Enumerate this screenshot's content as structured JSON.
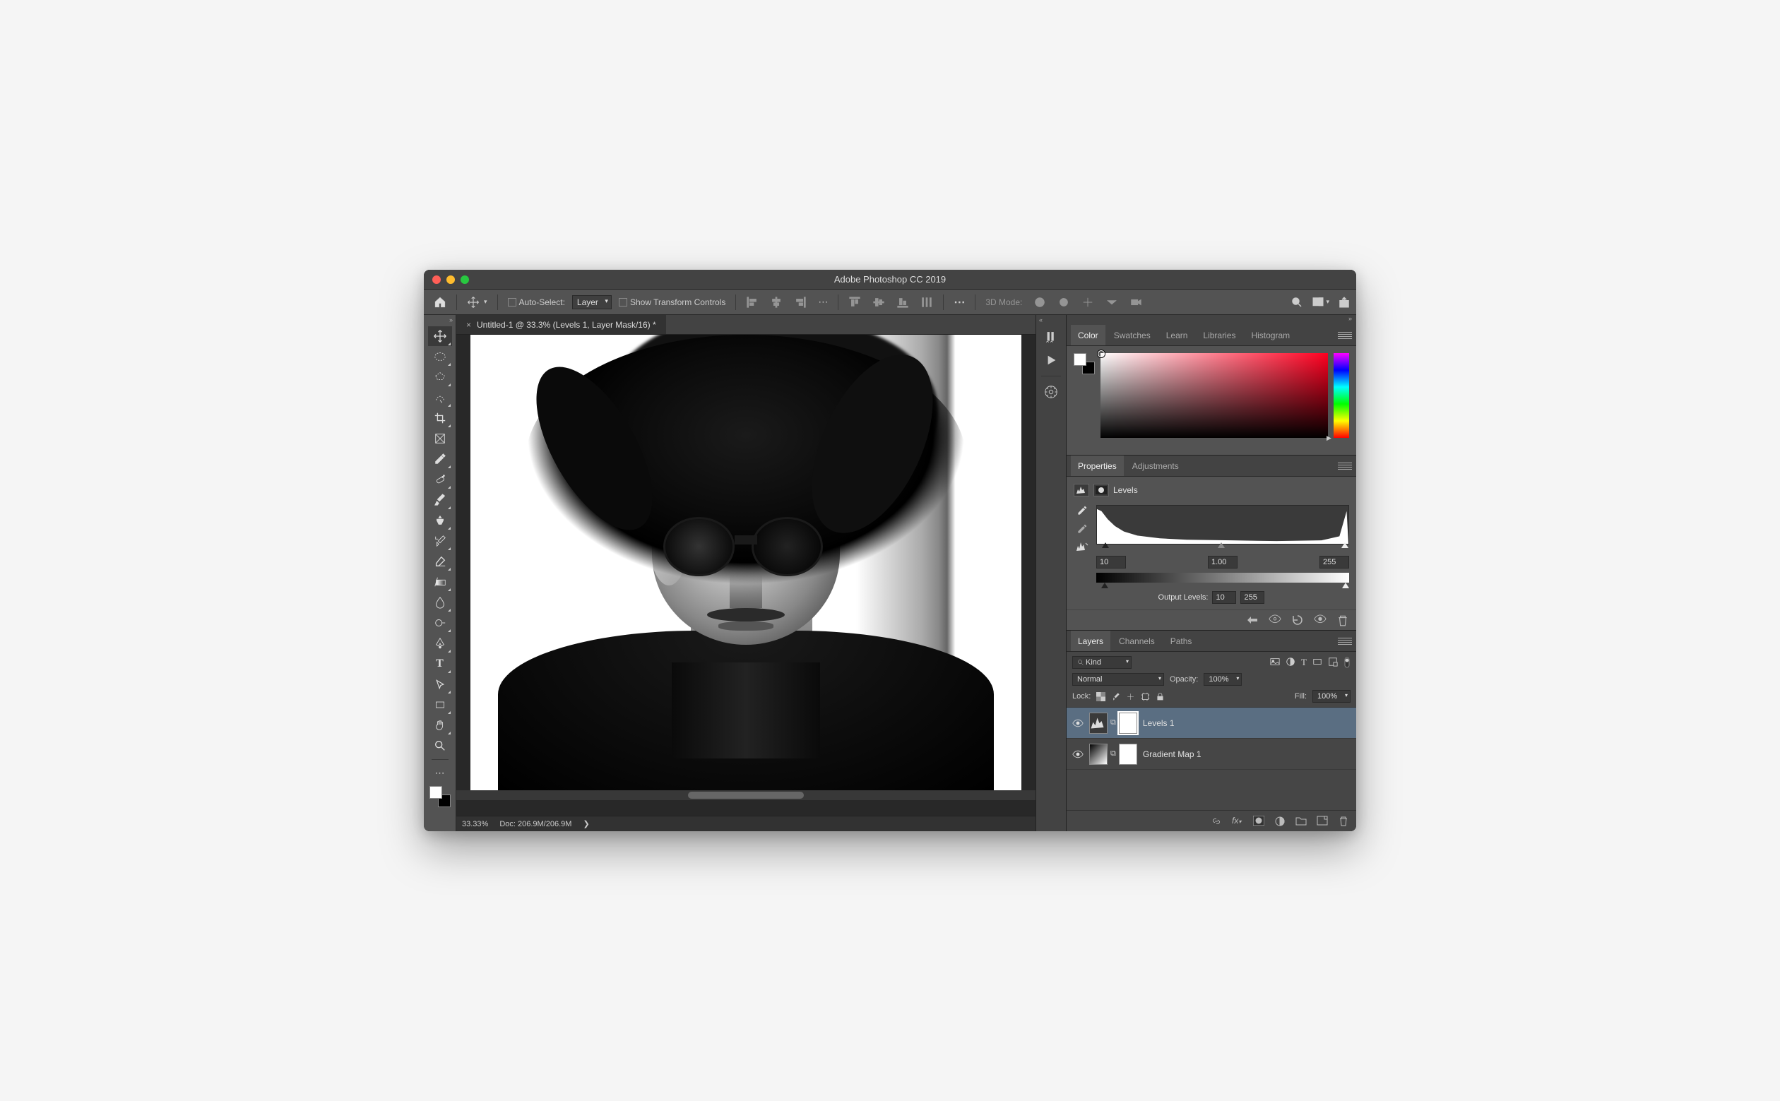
{
  "app": {
    "title": "Adobe Photoshop CC 2019"
  },
  "optionsBar": {
    "autoSelectLabel": "Auto-Select:",
    "autoSelectTarget": "Layer",
    "transformLabel": "Show Transform Controls",
    "threeDLabel": "3D Mode:"
  },
  "document": {
    "tabTitle": "Untitled-1 @ 33.3% (Levels 1, Layer Mask/16) *",
    "zoom": "33.33%",
    "docSize": "Doc: 206.9M/206.9M"
  },
  "panels": {
    "colorGroup": [
      "Color",
      "Swatches",
      "Learn",
      "Libraries",
      "Histogram"
    ],
    "propsGroup": [
      "Properties",
      "Adjustments"
    ],
    "layersGroup": [
      "Layers",
      "Channels",
      "Paths"
    ]
  },
  "properties": {
    "type": "Levels",
    "inputBlack": "10",
    "inputGamma": "1.00",
    "inputWhite": "255",
    "outputLabel": "Output Levels:",
    "outputBlack": "10",
    "outputWhite": "255"
  },
  "layers": {
    "filterKind": "Kind",
    "blendMode": "Normal",
    "opacityLabel": "Opacity:",
    "opacity": "100%",
    "lockLabel": "Lock:",
    "fillLabel": "Fill:",
    "fill": "100%",
    "items": [
      {
        "name": "Levels 1"
      },
      {
        "name": "Gradient Map 1"
      }
    ]
  }
}
